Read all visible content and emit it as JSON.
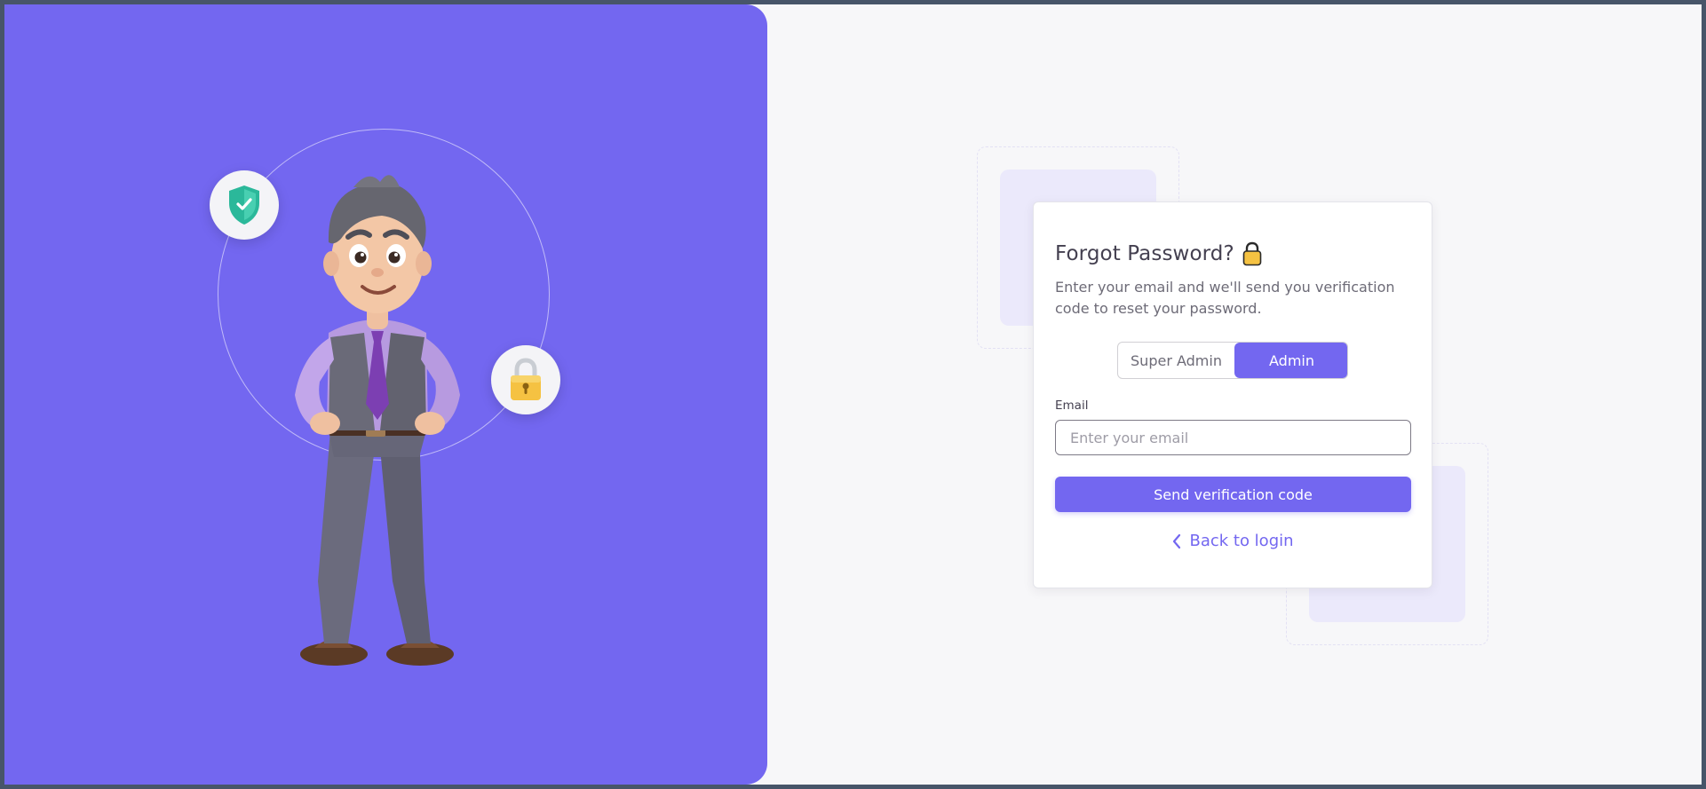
{
  "illustration": {
    "shield_icon": "shield-check-icon",
    "lock_icon": "padlock-icon"
  },
  "card": {
    "title": "Forgot Password?",
    "title_icon": "lock-emoji-icon",
    "subtitle": "Enter your email and we'll send you verification code to reset your password.",
    "roles": [
      {
        "label": "Super Admin",
        "selected": false
      },
      {
        "label": "Admin",
        "selected": true
      }
    ],
    "email": {
      "label": "Email",
      "placeholder": "Enter your email",
      "value": ""
    },
    "submit_label": "Send verification code",
    "back_label": "Back to login",
    "back_icon": "chevron-left-icon"
  },
  "colors": {
    "primary": "#7367f0",
    "panel": "#7367f0",
    "background": "#f7f7f9"
  }
}
